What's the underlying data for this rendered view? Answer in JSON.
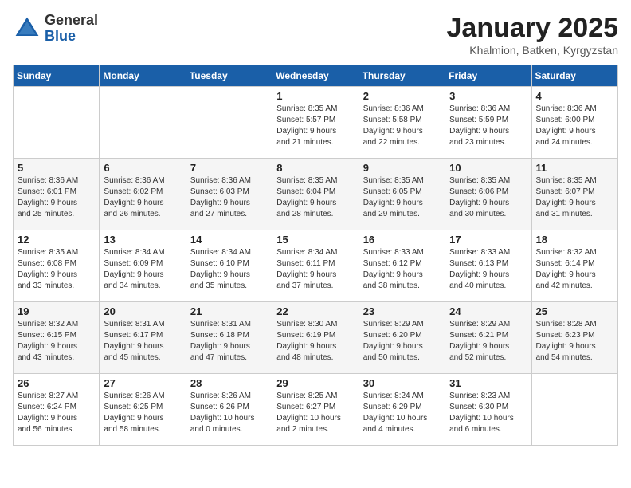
{
  "logo": {
    "general": "General",
    "blue": "Blue"
  },
  "header": {
    "month": "January 2025",
    "location": "Khalmion, Batken, Kyrgyzstan"
  },
  "weekdays": [
    "Sunday",
    "Monday",
    "Tuesday",
    "Wednesday",
    "Thursday",
    "Friday",
    "Saturday"
  ],
  "weeks": [
    [
      {
        "day": "",
        "info": ""
      },
      {
        "day": "",
        "info": ""
      },
      {
        "day": "",
        "info": ""
      },
      {
        "day": "1",
        "info": "Sunrise: 8:35 AM\nSunset: 5:57 PM\nDaylight: 9 hours\nand 21 minutes."
      },
      {
        "day": "2",
        "info": "Sunrise: 8:36 AM\nSunset: 5:58 PM\nDaylight: 9 hours\nand 22 minutes."
      },
      {
        "day": "3",
        "info": "Sunrise: 8:36 AM\nSunset: 5:59 PM\nDaylight: 9 hours\nand 23 minutes."
      },
      {
        "day": "4",
        "info": "Sunrise: 8:36 AM\nSunset: 6:00 PM\nDaylight: 9 hours\nand 24 minutes."
      }
    ],
    [
      {
        "day": "5",
        "info": "Sunrise: 8:36 AM\nSunset: 6:01 PM\nDaylight: 9 hours\nand 25 minutes."
      },
      {
        "day": "6",
        "info": "Sunrise: 8:36 AM\nSunset: 6:02 PM\nDaylight: 9 hours\nand 26 minutes."
      },
      {
        "day": "7",
        "info": "Sunrise: 8:36 AM\nSunset: 6:03 PM\nDaylight: 9 hours\nand 27 minutes."
      },
      {
        "day": "8",
        "info": "Sunrise: 8:35 AM\nSunset: 6:04 PM\nDaylight: 9 hours\nand 28 minutes."
      },
      {
        "day": "9",
        "info": "Sunrise: 8:35 AM\nSunset: 6:05 PM\nDaylight: 9 hours\nand 29 minutes."
      },
      {
        "day": "10",
        "info": "Sunrise: 8:35 AM\nSunset: 6:06 PM\nDaylight: 9 hours\nand 30 minutes."
      },
      {
        "day": "11",
        "info": "Sunrise: 8:35 AM\nSunset: 6:07 PM\nDaylight: 9 hours\nand 31 minutes."
      }
    ],
    [
      {
        "day": "12",
        "info": "Sunrise: 8:35 AM\nSunset: 6:08 PM\nDaylight: 9 hours\nand 33 minutes."
      },
      {
        "day": "13",
        "info": "Sunrise: 8:34 AM\nSunset: 6:09 PM\nDaylight: 9 hours\nand 34 minutes."
      },
      {
        "day": "14",
        "info": "Sunrise: 8:34 AM\nSunset: 6:10 PM\nDaylight: 9 hours\nand 35 minutes."
      },
      {
        "day": "15",
        "info": "Sunrise: 8:34 AM\nSunset: 6:11 PM\nDaylight: 9 hours\nand 37 minutes."
      },
      {
        "day": "16",
        "info": "Sunrise: 8:33 AM\nSunset: 6:12 PM\nDaylight: 9 hours\nand 38 minutes."
      },
      {
        "day": "17",
        "info": "Sunrise: 8:33 AM\nSunset: 6:13 PM\nDaylight: 9 hours\nand 40 minutes."
      },
      {
        "day": "18",
        "info": "Sunrise: 8:32 AM\nSunset: 6:14 PM\nDaylight: 9 hours\nand 42 minutes."
      }
    ],
    [
      {
        "day": "19",
        "info": "Sunrise: 8:32 AM\nSunset: 6:15 PM\nDaylight: 9 hours\nand 43 minutes."
      },
      {
        "day": "20",
        "info": "Sunrise: 8:31 AM\nSunset: 6:17 PM\nDaylight: 9 hours\nand 45 minutes."
      },
      {
        "day": "21",
        "info": "Sunrise: 8:31 AM\nSunset: 6:18 PM\nDaylight: 9 hours\nand 47 minutes."
      },
      {
        "day": "22",
        "info": "Sunrise: 8:30 AM\nSunset: 6:19 PM\nDaylight: 9 hours\nand 48 minutes."
      },
      {
        "day": "23",
        "info": "Sunrise: 8:29 AM\nSunset: 6:20 PM\nDaylight: 9 hours\nand 50 minutes."
      },
      {
        "day": "24",
        "info": "Sunrise: 8:29 AM\nSunset: 6:21 PM\nDaylight: 9 hours\nand 52 minutes."
      },
      {
        "day": "25",
        "info": "Sunrise: 8:28 AM\nSunset: 6:23 PM\nDaylight: 9 hours\nand 54 minutes."
      }
    ],
    [
      {
        "day": "26",
        "info": "Sunrise: 8:27 AM\nSunset: 6:24 PM\nDaylight: 9 hours\nand 56 minutes."
      },
      {
        "day": "27",
        "info": "Sunrise: 8:26 AM\nSunset: 6:25 PM\nDaylight: 9 hours\nand 58 minutes."
      },
      {
        "day": "28",
        "info": "Sunrise: 8:26 AM\nSunset: 6:26 PM\nDaylight: 10 hours\nand 0 minutes."
      },
      {
        "day": "29",
        "info": "Sunrise: 8:25 AM\nSunset: 6:27 PM\nDaylight: 10 hours\nand 2 minutes."
      },
      {
        "day": "30",
        "info": "Sunrise: 8:24 AM\nSunset: 6:29 PM\nDaylight: 10 hours\nand 4 minutes."
      },
      {
        "day": "31",
        "info": "Sunrise: 8:23 AM\nSunset: 6:30 PM\nDaylight: 10 hours\nand 6 minutes."
      },
      {
        "day": "",
        "info": ""
      }
    ]
  ]
}
